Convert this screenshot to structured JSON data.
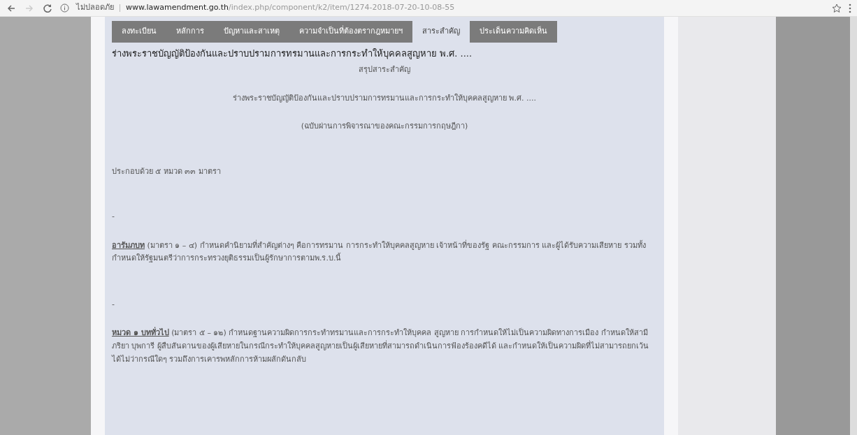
{
  "browser": {
    "security_label": "ไม่ปลอดภัย",
    "url_host": "www.lawamendment.go.th",
    "url_path": "/index.php/component/k2/item/1274-2018-07-20-10-08-55"
  },
  "tabs": [
    {
      "label": "ลงทะเบียน",
      "selected": false
    },
    {
      "label": "หลักการ",
      "selected": false
    },
    {
      "label": "ปัญหาและสาเหตุ",
      "selected": false
    },
    {
      "label": "ความจำเป็นที่ต้องตรากฎหมายฯ",
      "selected": false
    },
    {
      "label": "สาระสำคัญ",
      "selected": true
    },
    {
      "label": "ประเด็นความคิดเห็น",
      "selected": false
    }
  ],
  "article": {
    "title": "ร่างพระราชบัญญัติป้องกันและปราบปรามการทรมานและการกระทำให้บุคคลสูญหาย พ.ศ. ....",
    "summary_heading": "สรุปสาระสำคัญ",
    "law_name": "ร่างพระราชบัญญัติป้องกันและปราบปรามการทรมานและการกระทำให้บุคคลสูญหาย พ.ศ. ....",
    "version_note": "(ฉบับผ่านการพิจารณาของคณะกรรมการกฤษฎีกา)",
    "composition": "ประกอบด้วย ๕ หมวด ๓๓ มาตรา",
    "sections": [
      {
        "bullet": "-",
        "heading": "อารัมภบท",
        "body": " (มาตรา ๑ – ๔) กำหนดคำนิยามที่สำคัญต่างๆ คือการทรมาน การกระทำให้บุคคลสูญหาย เจ้าหน้าที่ของรัฐ คณะกรรมการ และผู้ได้รับความเสียหาย รวมทั้งกำหนดให้รัฐมนตรีว่าการกระทรวงยุติธรรมเป็นผู้รักษาการตามพ.ร.บ.นี้"
      },
      {
        "bullet": "-",
        "heading": "หมวด ๑ บททั่วไป",
        "body": " (มาตรา ๕ – ๑๒) กำหนดฐานความผิดการกระทำทรมานและการกระทำให้บุคคล สูญหาย การกำหนดให้ไม่เป็นความผิดทางการเมือง กำหนดให้สามี ภริยา บุพการี ผู้สืบสันดานของผู้เสียหายในกรณีกระทำให้บุคคลสูญหายเป็นผู้เสียหายที่สามารถดำเนินการฟ้องร้องคดีได้ และกำหนดให้เป็นความผิดที่ไม่สามารถยกเว้นได้ไม่ว่ากรณีใดๆ รวมถึงการเคารพหลักการห้ามผลักดันกลับ"
      }
    ]
  }
}
